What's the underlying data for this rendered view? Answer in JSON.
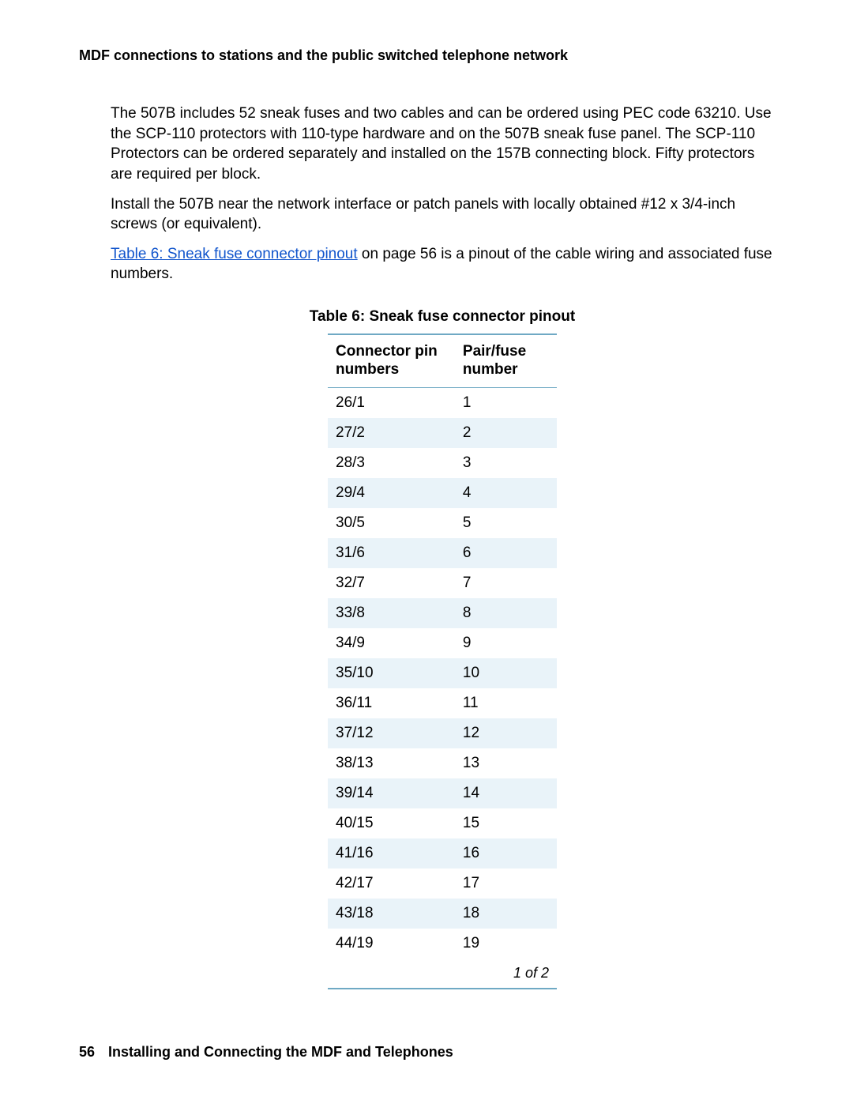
{
  "header": {
    "title": "MDF connections to stations and the public switched telephone network"
  },
  "paragraphs": {
    "p1": "The 507B includes 52 sneak fuses and two cables and can be ordered using PEC code 63210. Use the SCP-110 protectors with 110-type hardware and on the 507B sneak fuse panel. The SCP-110 Protectors can be ordered separately and installed on the 157B connecting block. Fifty protectors are required per block.",
    "p2": "Install the 507B near the network interface or patch panels with locally obtained #12 x 3/4-inch screws (or equivalent).",
    "p3_link": "Table 6:  Sneak fuse connector pinout",
    "p3_tail": " on page 56 is a pinout of the cable wiring and associated fuse numbers."
  },
  "table": {
    "caption": "Table 6: Sneak fuse connector pinout",
    "col1": "Connector pin numbers",
    "col2": "Pair/fuse number",
    "rows": [
      {
        "pin": "26/1",
        "fuse": "1"
      },
      {
        "pin": "27/2",
        "fuse": "2"
      },
      {
        "pin": "28/3",
        "fuse": "3"
      },
      {
        "pin": "29/4",
        "fuse": "4"
      },
      {
        "pin": "30/5",
        "fuse": "5"
      },
      {
        "pin": "31/6",
        "fuse": "6"
      },
      {
        "pin": "32/7",
        "fuse": "7"
      },
      {
        "pin": "33/8",
        "fuse": "8"
      },
      {
        "pin": "34/9",
        "fuse": "9"
      },
      {
        "pin": "35/10",
        "fuse": "10"
      },
      {
        "pin": "36/11",
        "fuse": "11"
      },
      {
        "pin": "37/12",
        "fuse": "12"
      },
      {
        "pin": "38/13",
        "fuse": "13"
      },
      {
        "pin": "39/14",
        "fuse": "14"
      },
      {
        "pin": "40/15",
        "fuse": "15"
      },
      {
        "pin": "41/16",
        "fuse": "16"
      },
      {
        "pin": "42/17",
        "fuse": "17"
      },
      {
        "pin": "43/18",
        "fuse": "18"
      },
      {
        "pin": "44/19",
        "fuse": "19"
      }
    ],
    "pagination": "1 of 2"
  },
  "footer": {
    "page_number": "56",
    "book_title": "Installing and Connecting the MDF and Telephones"
  }
}
